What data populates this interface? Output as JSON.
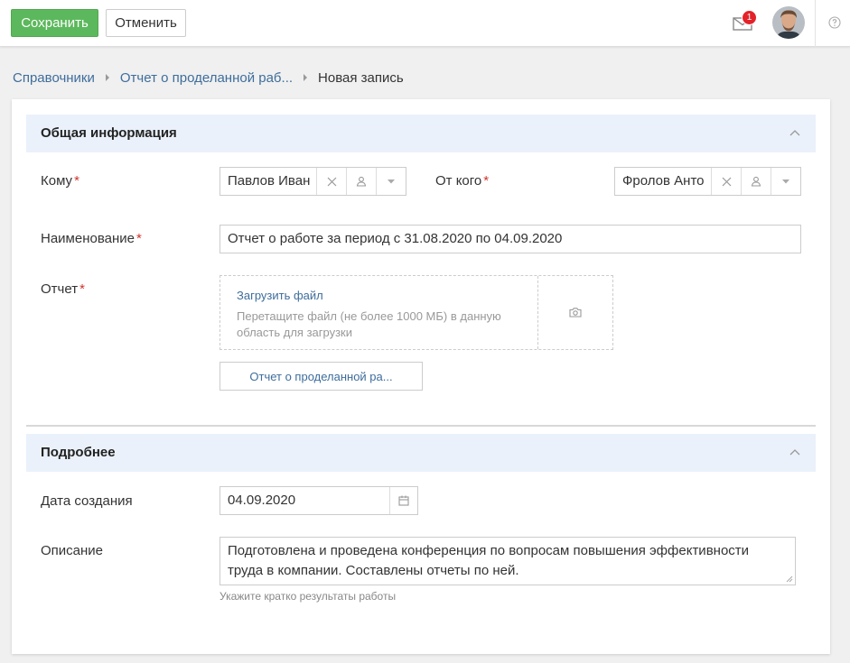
{
  "toolbar": {
    "save_label": "Сохранить",
    "cancel_label": "Отменить"
  },
  "header": {
    "notifications_count": "1",
    "mail_icon": "mail-icon",
    "help_icon": "help-icon",
    "accent_color": "#5cb85c",
    "badge_color": "#e3222a"
  },
  "breadcrumb": {
    "items": [
      "Справочники",
      "Отчет о проделанной раб..."
    ],
    "current": "Новая запись"
  },
  "section_general": {
    "title": "Общая информация",
    "to_label": "Кому",
    "to_value": "Павлов Иван",
    "from_label": "От кого",
    "from_value": "Фролов Анто",
    "name_label": "Наименование",
    "name_value": "Отчет о работе за период с 31.08.2020 по 04.09.2020",
    "report_label": "Отчет",
    "upload_link": "Загрузить файл",
    "upload_hint": "Перетащите файл (не более 1000 МБ) в данную область для загрузки",
    "attached_file": "Отчет о проделанной ра..."
  },
  "section_details": {
    "title": "Подробнее",
    "date_label": "Дата создания",
    "date_value": "04.09.2020",
    "description_label": "Описание",
    "description_value": "Подготовлена и проведена конференция по вопросам повышения эффективности труда в компании. Составлены отчеты по ней.",
    "description_hint": "Укажите кратко результаты работы"
  },
  "required_mark": "*"
}
